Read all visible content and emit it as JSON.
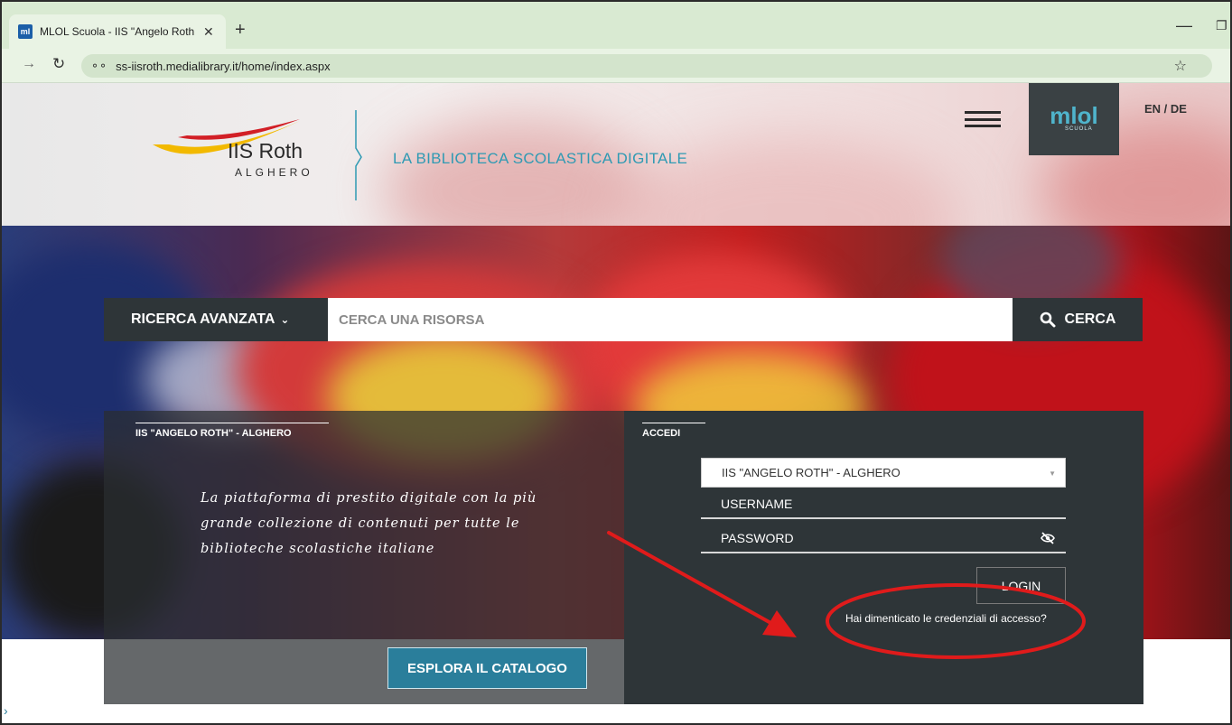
{
  "browser": {
    "tab_title": "MLOL Scuola - IIS \"Angelo Roth",
    "favicon_label": "ml",
    "url": "ss-iisroth.medialibrary.it/home/index.aspx",
    "icons": [
      "forward-arrow-icon",
      "reload-icon",
      "site-info-icon",
      "star-icon",
      "close-icon",
      "new-tab-icon",
      "minimize-icon",
      "restore-icon"
    ]
  },
  "header": {
    "logo_name": "IIS Roth",
    "logo_city": "ALGHERO",
    "tagline": "LA BIBLIOTECA SCOLASTICA DIGITALE",
    "mlol_logo": "mlol",
    "mlol_sub": "SCUOLA",
    "lang_switch": "EN / DE"
  },
  "search": {
    "advanced_label": "RICERCA AVANZATA",
    "placeholder": "CERCA UNA RISORSA",
    "button_label": "CERCA"
  },
  "info": {
    "heading": "IIS \"ANGELO ROTH\" - ALGHERO",
    "description": "La piattaforma di prestito digitale con la più grande collezione di contenuti per tutte le biblioteche scolastiche italiane",
    "explore_label": "ESPLORA IL CATALOGO"
  },
  "login": {
    "heading": "ACCEDI",
    "library_selected": "IIS \"ANGELO ROTH\" - ALGHERO",
    "username_placeholder": "USERNAME",
    "password_placeholder": "PASSWORD",
    "login_label": "LOGIN",
    "forgot_text": "Hai dimenticato le credenziali di accesso?"
  },
  "colors": {
    "accent_teal": "#2a7e9b",
    "panel_dark": "#2e3538",
    "annotation_red": "#e01b1b",
    "tagline_blue": "#2f9ab3"
  }
}
